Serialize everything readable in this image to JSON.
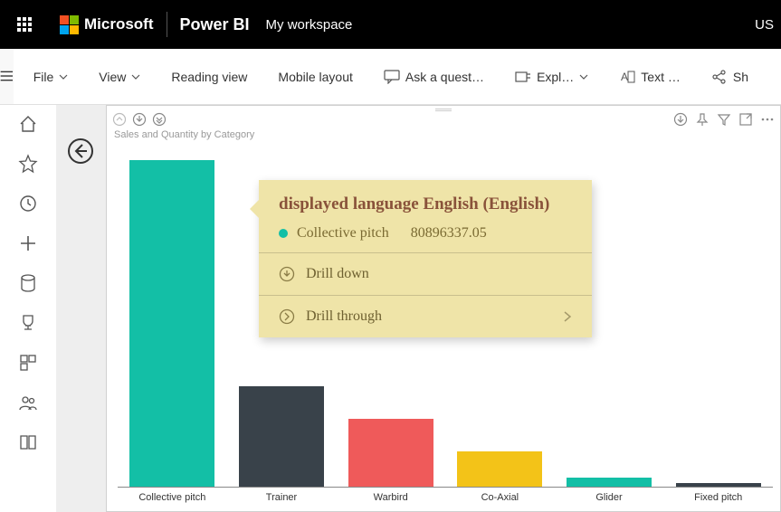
{
  "header": {
    "brand": "Microsoft",
    "product": "Power BI",
    "workspace": "My workspace",
    "user_region": "US"
  },
  "toolbar": {
    "file": "File",
    "view": "View",
    "reading_view": "Reading view",
    "mobile_layout": "Mobile layout",
    "ask": "Ask a quest…",
    "explore": "Expl…",
    "text": "Text …",
    "share": "Sh"
  },
  "visual": {
    "title": "Sales and Quantity by Category"
  },
  "tooltip": {
    "title": "displayed language English (English)",
    "series_label": "Collective pitch",
    "value": "80896337.05",
    "drill_down": "Drill down",
    "drill_through": "Drill through"
  },
  "chart_data": {
    "type": "bar",
    "title": "Sales and Quantity by Category",
    "xlabel": "",
    "ylabel": "",
    "categories": [
      "Collective pitch",
      "Trainer",
      "Warbird",
      "Co-Axial",
      "Glider",
      "Fixed pitch"
    ],
    "series": [
      {
        "name": "Sales",
        "values": [
          80896337.05,
          25000000,
          17000000,
          9000000,
          2500000,
          1200000
        ]
      }
    ],
    "colors": [
      "#13bfa6",
      "#39424a",
      "#ef5a5a",
      "#f3c318",
      "#13bfa6",
      "#39424a"
    ],
    "ylim": [
      0,
      85000000
    ]
  }
}
